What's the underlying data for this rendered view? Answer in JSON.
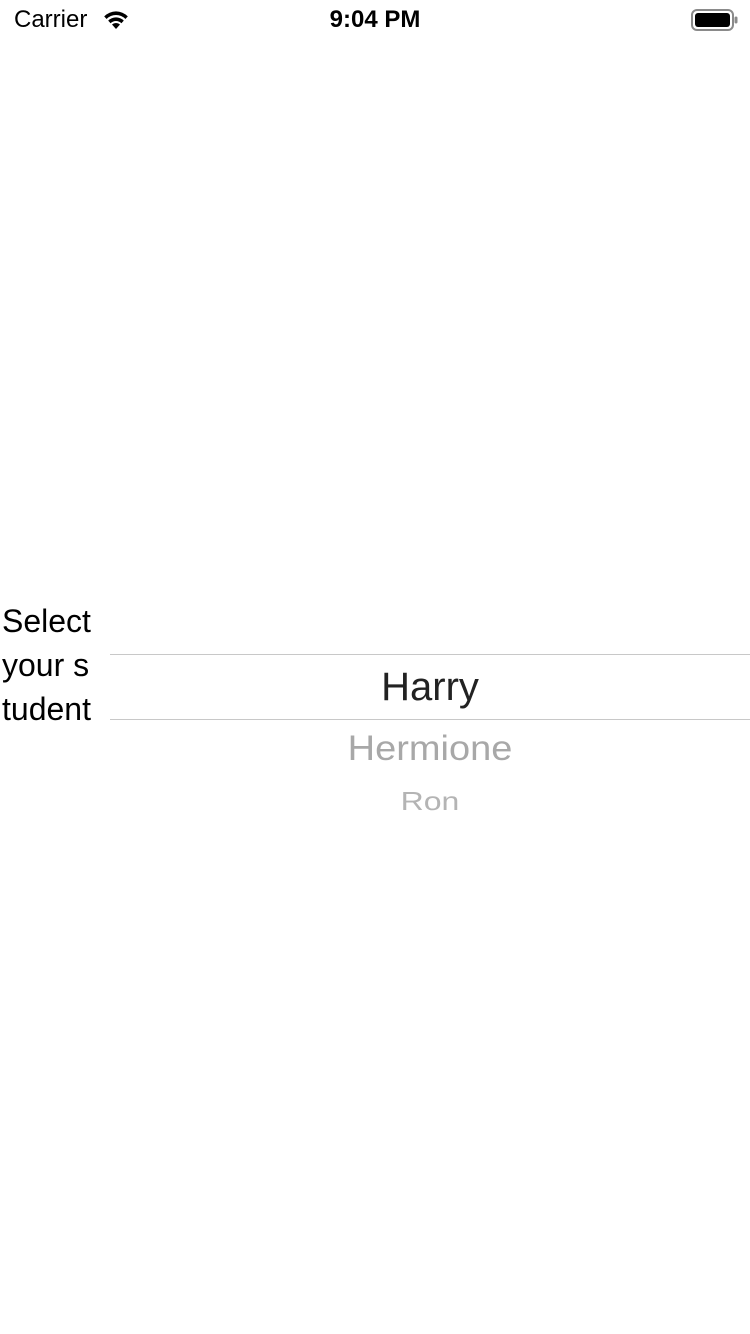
{
  "status_bar": {
    "carrier": "Carrier",
    "time": "9:04 PM",
    "wifi_icon": "wifi-icon",
    "battery_icon": "battery-icon"
  },
  "label": {
    "text": "Select your student"
  },
  "picker": {
    "options": [
      "Harry",
      "Hermione",
      "Ron"
    ],
    "selected": "Harry",
    "selection_line_color": "#c8c8c8"
  }
}
